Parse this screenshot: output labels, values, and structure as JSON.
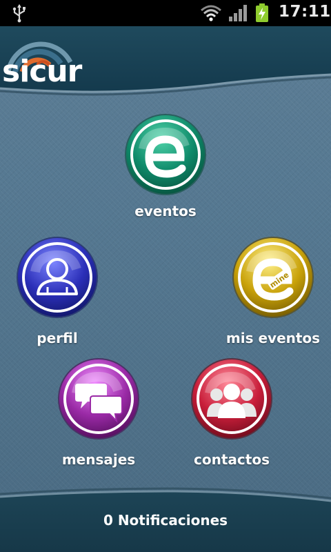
{
  "status_bar": {
    "time": "17:11",
    "icons": [
      "usb-icon",
      "wifi-icon",
      "signal-icon",
      "battery-charging-icon"
    ]
  },
  "header": {
    "logo_text": "sicur"
  },
  "menu": {
    "eventos": {
      "label": "eventos",
      "icon": "event-e-icon",
      "color": "#0f8a6a"
    },
    "perfil": {
      "label": "perfil",
      "icon": "user-profile-icon",
      "color": "#2b2fb8"
    },
    "mis_eventos": {
      "label": "mis eventos",
      "icon": "mine-e-icon",
      "badge": "mine",
      "color": "#c9a20a"
    },
    "mensajes": {
      "label": "mensajes",
      "icon": "chat-bubbles-icon",
      "color": "#9a2aa6"
    },
    "contactos": {
      "label": "contactos",
      "icon": "group-icon",
      "color": "#c81e3a"
    }
  },
  "footer": {
    "notifications": "0 Notificaciones"
  }
}
